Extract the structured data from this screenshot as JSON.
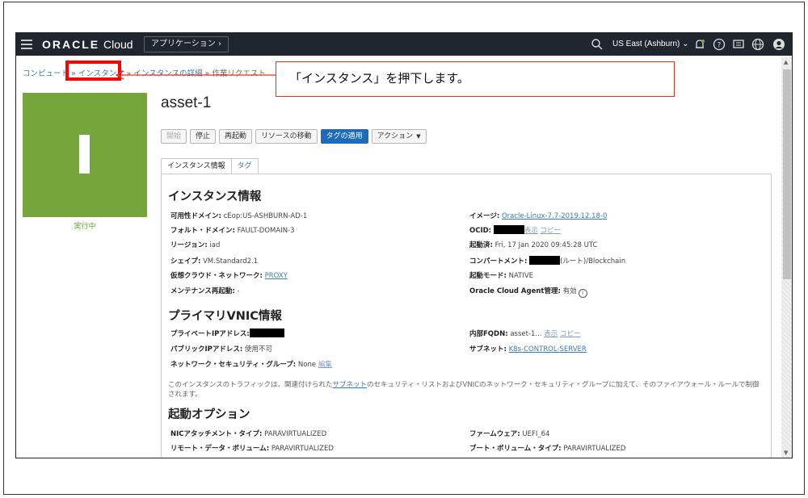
{
  "header": {
    "brand_oracle": "ORACLE",
    "brand_cloud": "Cloud",
    "apps_button": "アプリケーション",
    "region": "US East (Ashburn)",
    "icons": [
      "menu-icon",
      "search-icon",
      "bell-icon",
      "help-icon",
      "chat-icon",
      "globe-icon",
      "user-icon"
    ]
  },
  "breadcrumb": {
    "compute": "コンピュート",
    "instances": "インスタンス",
    "details": "インスタンスの詳細",
    "sep": "»",
    "work_requests": "作業リクエスト"
  },
  "callout": "「インスタンス」を押下します。",
  "tile": {
    "status": "実行中",
    "color": "#76a53a"
  },
  "title": "asset-1",
  "actions": {
    "start": "開始",
    "stop": "停止",
    "reboot": "再起動",
    "move": "リソースの移動",
    "apply_tags": "タグの適用",
    "more": "アクション"
  },
  "tabs": {
    "info": "インスタンス情報",
    "tags": "タグ"
  },
  "instance_info": {
    "heading": "インスタンス情報",
    "left": [
      {
        "k": "可用性ドメイン:",
        "v": "cEop:US-ASHBURN-AD-1"
      },
      {
        "k": "フォルト・ドメイン:",
        "v": "FAULT-DOMAIN-3"
      },
      {
        "k": "リージョン:",
        "v": "iad"
      },
      {
        "k": "シェイプ:",
        "v": "VM.Standard2.1"
      },
      {
        "k": "仮想クラウド・ネットワーク:",
        "v": "PROXY"
      },
      {
        "k": "メンテナンス再起動:",
        "v": "-"
      }
    ],
    "right": [
      {
        "k": "イメージ:",
        "v": "Oracle-Linux-7.7-2019.12.18-0"
      },
      {
        "k": "OCID:",
        "v": "",
        "show": "表示",
        "copy": "コピー"
      },
      {
        "k": "起動済:",
        "v": "Fri, 17 Jan 2020 09:45:28 UTC"
      },
      {
        "k": "コンパートメント:",
        "v": "(ルート)/Blockchain"
      },
      {
        "k": "起動モード:",
        "v": "NATIVE"
      },
      {
        "k": "Oracle Cloud Agent管理:",
        "v": "有効"
      }
    ]
  },
  "vnic": {
    "heading": "プライマリVNIC情報",
    "private_ip_k": "プライベートIPアドレス:",
    "public_ip_k": "パブリックIPアドレス:",
    "public_ip_v": "使用不可",
    "nsg_k": "ネットワーク・セキュリティ・グループ:",
    "nsg_v": "None",
    "nsg_edit": "編集",
    "fqdn_k": "内部FQDN:",
    "fqdn_v": "asset-1...",
    "fqdn_show": "表示",
    "fqdn_copy": "コピー",
    "subnet_k": "サブネット:",
    "subnet_v": "K8s-CONTROL-SERVER",
    "note_pre": "このインスタンスのトラフィックは、関連付けられた",
    "note_link": "サブネット",
    "note_post": "のセキュリティ・リストおよびVNICのネットワーク・セキュリティ・グループに加えて、そのファイアウォール・ルールで制御されます。"
  },
  "launch": {
    "heading": "起動オプション",
    "nic_k": "NICアタッチメント・タイプ:",
    "nic_v": "PARAVIRTUALIZED",
    "remote_k": "リモート・データ・ボリューム:",
    "remote_v": "PARAVIRTUALIZED",
    "firmware_k": "ファームウェア:",
    "firmware_v": "UEFI_64",
    "boot_k": "ブート・ボリューム・タイプ:",
    "boot_v": "PARAVIRTUALIZED"
  }
}
